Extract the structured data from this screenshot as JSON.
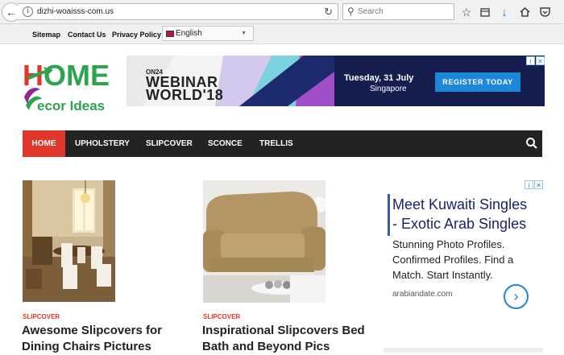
{
  "browser": {
    "url": "dizhi-woaisss-com.us",
    "search_placeholder": "Search",
    "info_icon": "i",
    "reload_icon": "reload-icon",
    "back_icon": "back-arrow-icon"
  },
  "topnav": {
    "links": [
      "Sitemap",
      "Contact Us",
      "Privacy Policy"
    ],
    "language": "English"
  },
  "logo": {
    "home": "HOME",
    "sub": "ecor Ideas",
    "colors": {
      "h": "#e0362b",
      "ome": "#2ea44f",
      "sub": "#2ea44f",
      "leaf": "#8e2a8e"
    }
  },
  "banner_ad": {
    "brand": "ON24",
    "line1": "WEBINAR",
    "line2": "WORLD'18",
    "date": "Tuesday, 31 July",
    "city": "Singapore",
    "cta": "REGISTER TODAY"
  },
  "mainnav": {
    "items": [
      "HOME",
      "UPHOLSTERY",
      "SLIPCOVER",
      "SCONCE",
      "TRELLIS"
    ],
    "accent": "#e0362b"
  },
  "posts": [
    {
      "category": "SLIPCOVER",
      "title_line1": "Awesome Slipcovers for",
      "title_line2": "Dining Chairs Pictures"
    },
    {
      "category": "SLIPCOVER",
      "title_line1": "Inspirational Slipcovers Bed",
      "title_line2": "Bath and Beyond Pics"
    }
  ],
  "side_ad": {
    "headline1": "Meet Kuwaiti Singles",
    "headline2": "- Exotic Arab Singles",
    "body1": "Stunning Photo Profiles.",
    "body2": "Confirmed Profiles. Find a",
    "body3": "Match. Start Instantly.",
    "domain": "arabiandate.com"
  }
}
